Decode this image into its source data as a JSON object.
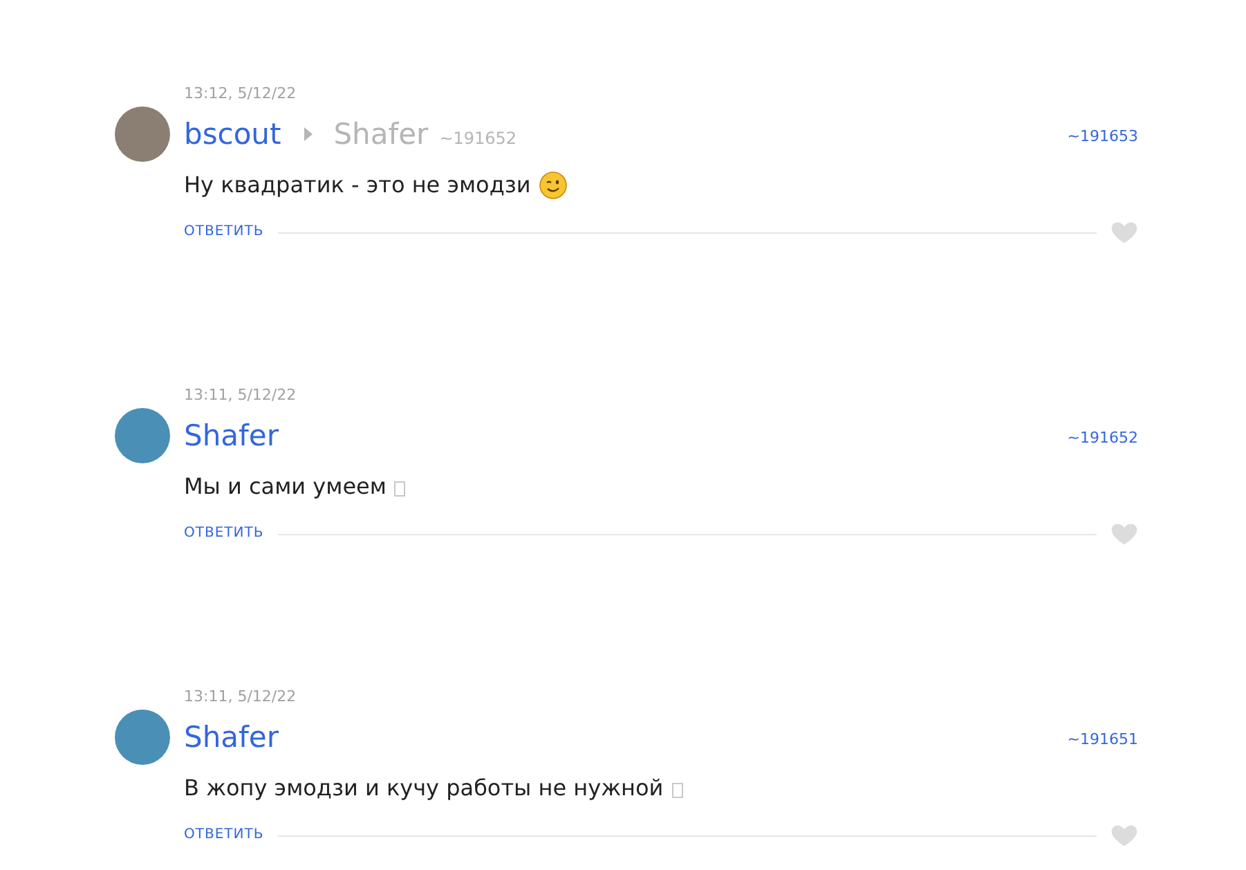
{
  "comments": [
    {
      "time": "13:12, 5/12/22",
      "author": "bscout",
      "reply_to": {
        "name": "Shafer",
        "ref": "~191652"
      },
      "ref": "~191653",
      "text": "Ну квадратик - это не эмодзи",
      "kind": "wink",
      "reply": "ОТВЕТИТЬ"
    },
    {
      "time": "13:11, 5/12/22",
      "author": "Shafer",
      "ref": "~191652",
      "text": "Мы и сами умеем",
      "kind": "missing-glyph",
      "reply": "ОТВЕТИТЬ"
    },
    {
      "time": "13:11, 5/12/22",
      "author": "Shafer",
      "ref": "~191651",
      "text": "В жопу эмодзи и кучу работы не нужной",
      "kind": "missing-glyph",
      "reply": "ОТВЕТИТЬ"
    }
  ]
}
